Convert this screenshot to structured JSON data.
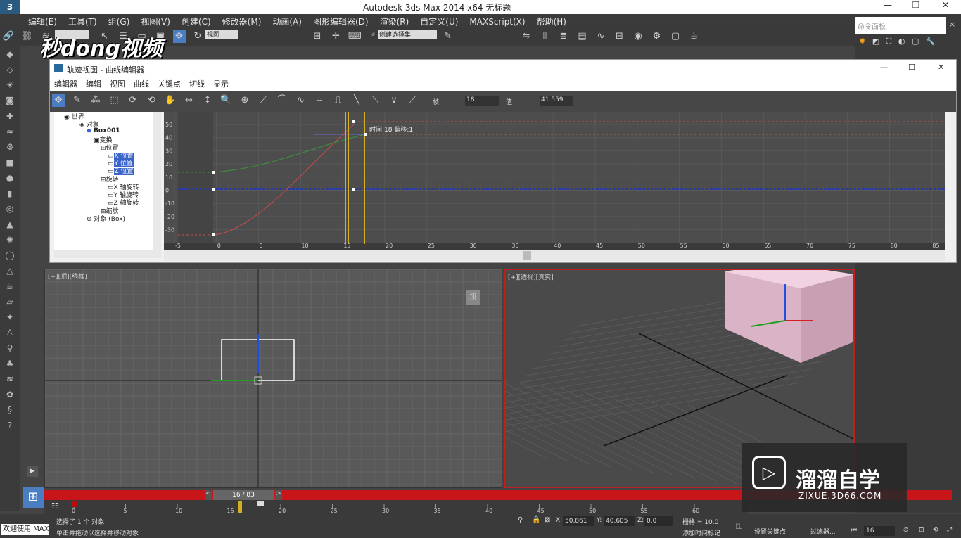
{
  "window": {
    "title": "Autodesk 3ds Max  2014 x64    无标题"
  },
  "menubar": {
    "items": [
      "编辑(E)",
      "工具(T)",
      "组(G)",
      "视图(V)",
      "创建(C)",
      "修改器(M)",
      "动画(A)",
      "图形编辑器(D)",
      "渲染(R)",
      "自定义(U)",
      "MAXScript(X)",
      "帮助(H)"
    ]
  },
  "toolbar": {
    "view_select": "视图",
    "selection_set": "创建选择集"
  },
  "logo_text": "秒dong视频",
  "command_panel": {
    "search_placeholder": "命令面板"
  },
  "curve_editor": {
    "title": "轨迹视图 - 曲线编辑器",
    "menu": [
      "编辑器",
      "编辑",
      "视图",
      "曲线",
      "关键点",
      "切线",
      "显示"
    ],
    "frame_label": "帧",
    "frame_value": "18",
    "value_label": "值",
    "value_value": "41.559",
    "tree": {
      "world": "世界",
      "objects": "对象",
      "box": "Box001",
      "transform": "变换",
      "position": "位置",
      "x_pos": "X 位置",
      "y_pos": "Y 位置",
      "z_pos": "Z 位置",
      "rotation": "旋转",
      "x_rot": "X 轴旋转",
      "y_rot": "Y 轴旋转",
      "z_rot": "Z 轴旋转",
      "scale": "缩放",
      "object_box": "对象 (Box)"
    },
    "tooltip": "时间:18  偏移:1",
    "y_ticks": [
      "50",
      "40",
      "30",
      "20",
      "10",
      "0",
      "-10",
      "-20",
      "-30"
    ],
    "x_ticks": [
      "-5",
      "0",
      "5",
      "10",
      "15",
      "20",
      "25",
      "30",
      "35",
      "40",
      "45",
      "50",
      "55",
      "60",
      "65",
      "70",
      "75",
      "80",
      "85"
    ]
  },
  "viewports": {
    "top_label": "[+][顶][线框]",
    "persp_label": "[+][透视][真实]",
    "top_cube_label": "顶"
  },
  "timeline": {
    "frame_display": "16 / 83"
  },
  "trackbar": {
    "ticks": [
      "0",
      "5",
      "10",
      "15",
      "20",
      "25",
      "30",
      "35",
      "40",
      "45",
      "50",
      "55",
      "60"
    ]
  },
  "status": {
    "welcome": "欢迎使用 MAX",
    "selected": "选择了 1 个 对象",
    "prompt": "单击并拖动以选择并移动对象",
    "x_label": "X:",
    "x_value": "50.861",
    "y_label": "Y:",
    "y_value": "40.605",
    "z_label": "Z:",
    "z_value": "0.0",
    "grid": "栅格 = 10.0",
    "add_time_tag": "添加时间标记",
    "set_key": "设置关键点",
    "filter": "过滤器...",
    "frame": "16"
  },
  "watermark": {
    "title": "溜溜自学",
    "url": "ZIXUE.3D66.COM"
  }
}
